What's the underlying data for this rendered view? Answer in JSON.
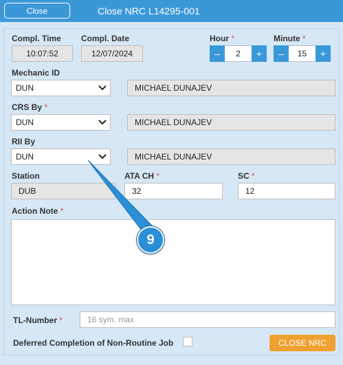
{
  "header": {
    "close_label": "Close",
    "title": "Close NRC L14295-001",
    "color": "#3b98d8"
  },
  "form": {
    "compl_time": {
      "label": "Compl. Time",
      "value": "10:07:52"
    },
    "compl_date": {
      "label": "Compl. Date",
      "value": "12/07/2024"
    },
    "hour": {
      "label": "Hour",
      "value": "2",
      "minus": "–",
      "plus": "+"
    },
    "minute": {
      "label": "Minute",
      "value": "15",
      "minus": "–",
      "plus": "+"
    },
    "mechanic_id": {
      "label": "Mechanic ID",
      "selected": "DUN",
      "name": "MICHAEL DUNAJEV"
    },
    "crs_by": {
      "label": "CRS By",
      "selected": "DUN",
      "name": "MICHAEL DUNAJEV"
    },
    "rii_by": {
      "label": "RII By",
      "selected": "DUN",
      "name": "MICHAEL DUNAJEV"
    },
    "station": {
      "label": "Station",
      "value": "DUB"
    },
    "ata_ch": {
      "label": "ATA CH",
      "value": "32"
    },
    "sc": {
      "label": "SC",
      "value": "12"
    },
    "action_note": {
      "label": "Action Note",
      "value": ""
    },
    "tl_number": {
      "label": "TL-Number",
      "placeholder": "16 sym. max"
    },
    "deferred": {
      "label": "Deferred Completion of Non-Routine Job",
      "checked": false
    },
    "required_mark": "*",
    "close_nrc_label": "CLOSE NRC"
  },
  "annotation": {
    "marker_label": "9",
    "color": "#2a8fd6"
  },
  "colors": {
    "accent": "#3b98d8",
    "action_button": "#f0a030",
    "required": "#d9534f"
  }
}
